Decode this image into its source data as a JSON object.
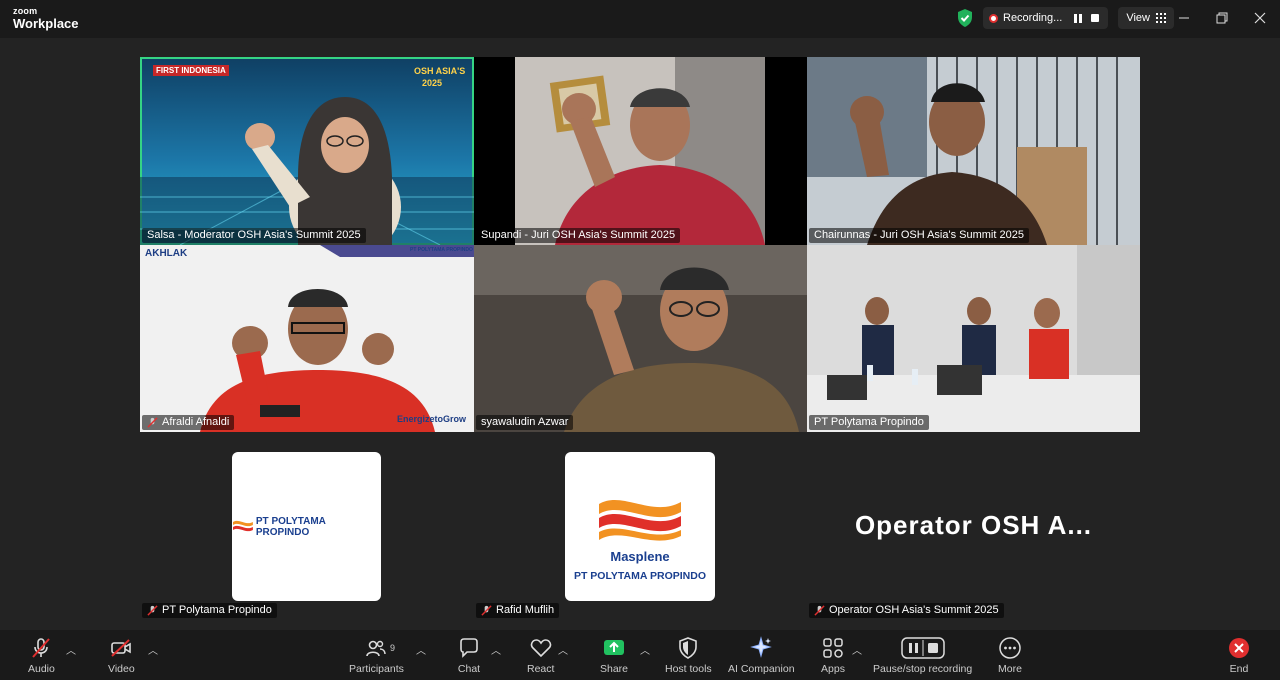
{
  "titlebar": {
    "logo_line1": "zoom",
    "logo_line2": "Workplace",
    "recording_label": "Recording...",
    "view_label": "View",
    "icons": [
      "shield-check-icon",
      "recording-dot-icon",
      "pause-icon",
      "stop-icon",
      "grid-icon",
      "minimize-icon",
      "restore-icon",
      "close-icon"
    ]
  },
  "participants": [
    {
      "name": "Salsa - Moderator OSH Asia's Summit 2025",
      "active": true,
      "bg": "#1f6ea0"
    },
    {
      "name": "Supandi - Juri OSH Asia's Summit 2025",
      "bg": "#c7c2bd"
    },
    {
      "name": "Chairunnas - Juri OSH Asia's Summit 2025",
      "bg": "#9aa4ab"
    },
    {
      "name": "Afraldi Afnaldi",
      "muted": true,
      "bg": "#f1f1f1"
    },
    {
      "name": "syawaludin Azwar",
      "bg": "#3a3530"
    },
    {
      "name": "PT Polytama Propindo",
      "bg": "#d4d4d4"
    },
    {
      "name": "PT Polytama Propindo",
      "muted": true
    },
    {
      "name": "Rafid Muflih",
      "muted": true
    },
    {
      "name": "Operator OSH Asia's Summit 2025",
      "muted": true
    }
  ],
  "overlays": {
    "event_logo": "FIRST INDONESIA",
    "event_badge": "OSH ASIA'S",
    "event_year": "2025",
    "brand_left": "AKHLAK",
    "brand_right": "PT POLYTAMA PROPINDO",
    "slogan": "EnergizetoGrow"
  },
  "tiles": {
    "logo_tile_text": "PT POLYTAMA PROPINDO",
    "masplene_brand": "Masplene",
    "masplene_company": "PT POLYTAMA PROPINDO",
    "operator_display": "Operator OSH A..."
  },
  "toolbar": {
    "audio": "Audio",
    "video": "Video",
    "participants": "Participants",
    "participants_count": "9",
    "chat": "Chat",
    "react": "React",
    "share": "Share",
    "host_tools": "Host tools",
    "ai_companion": "AI Companion",
    "apps": "Apps",
    "pause_stop": "Pause/stop recording",
    "more": "More",
    "end": "End"
  },
  "colors": {
    "active_border": "#35d484",
    "share_green": "#21c160",
    "end_red": "#e02f2f",
    "mute_red": "#e02f2f",
    "masplene_orange": "#f29222",
    "masplene_red": "#e0302a",
    "masplene_blue": "#1a3f8f"
  }
}
